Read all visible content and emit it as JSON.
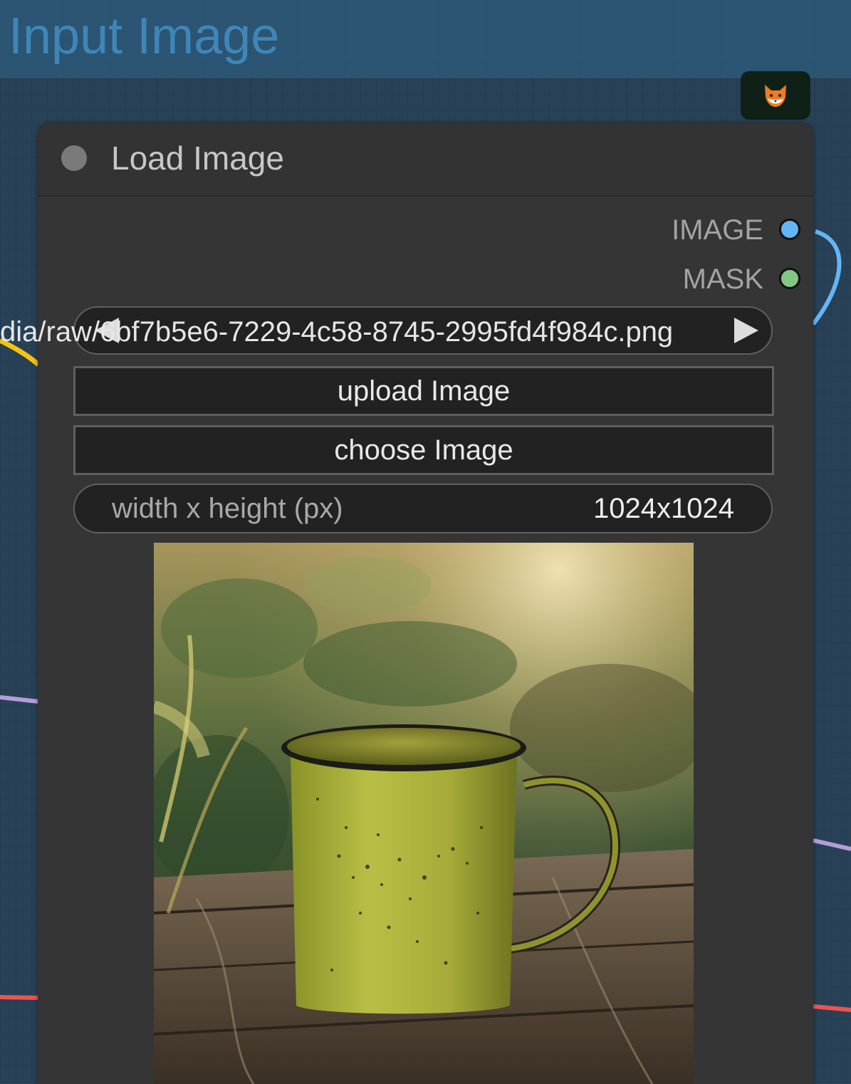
{
  "group": {
    "title": "Input Image",
    "background_color": "#305473"
  },
  "badge": {
    "icon": "fox-face-icon"
  },
  "node": {
    "title": "Load Image",
    "outputs": [
      {
        "label": "IMAGE",
        "color": "#64b5f6"
      },
      {
        "label": "MASK",
        "color": "#81c784"
      }
    ],
    "image_widget": {
      "value_overflow": "dia/raw/",
      "value": "6bf7b5e6-7229-4c58-8745-2995fd4f984c.png"
    },
    "upload_button": "upload Image",
    "choose_button": "choose Image",
    "size_widget": {
      "label": "width x height (px)",
      "value": "1024x1024"
    },
    "preview": {
      "subject": "olive-green enamel mug on wooden planks"
    }
  },
  "wire_colors": {
    "image": "#64b5f6",
    "yellow": "#f2c40f",
    "purple": "#b39ddb",
    "red": "#ef5350"
  }
}
